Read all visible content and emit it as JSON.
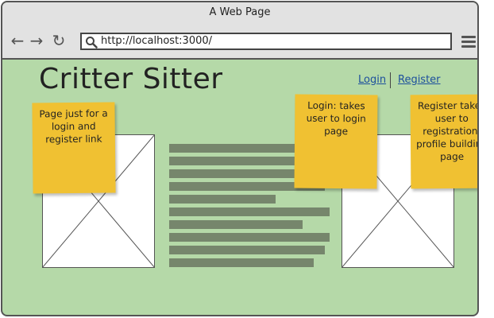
{
  "window": {
    "title": "A Web Page",
    "url": "http://localhost:3000/"
  },
  "page": {
    "title": "Critter Sitter",
    "links": {
      "login": "Login",
      "register": "Register"
    }
  },
  "notes": [
    "Page just for a login and register link",
    "Login: takes user to login page",
    "Register takes user to registration/ profile building page"
  ]
}
